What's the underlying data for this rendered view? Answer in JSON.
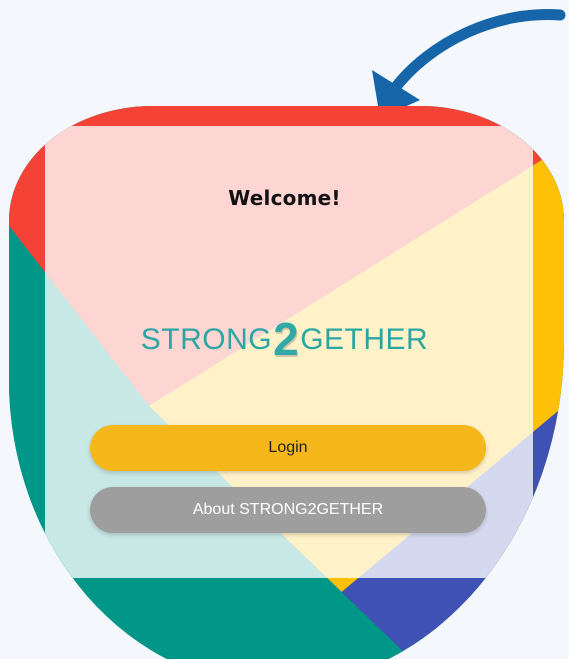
{
  "screen": {
    "welcome_text": "Welcome!",
    "logo": {
      "before": "STRONG",
      "digit": "2",
      "after": "GETHER"
    },
    "login_label": "Login",
    "about_label": "About STRONG2GETHER"
  },
  "colors": {
    "arrow": "#1565a8",
    "red": "#f44336",
    "yellow": "#ffc107",
    "teal": "#009688",
    "indigo": "#3f51b5",
    "login_button": "#f5b719",
    "about_button": "#9e9e9e",
    "logo_text": "#2aa6a3"
  }
}
